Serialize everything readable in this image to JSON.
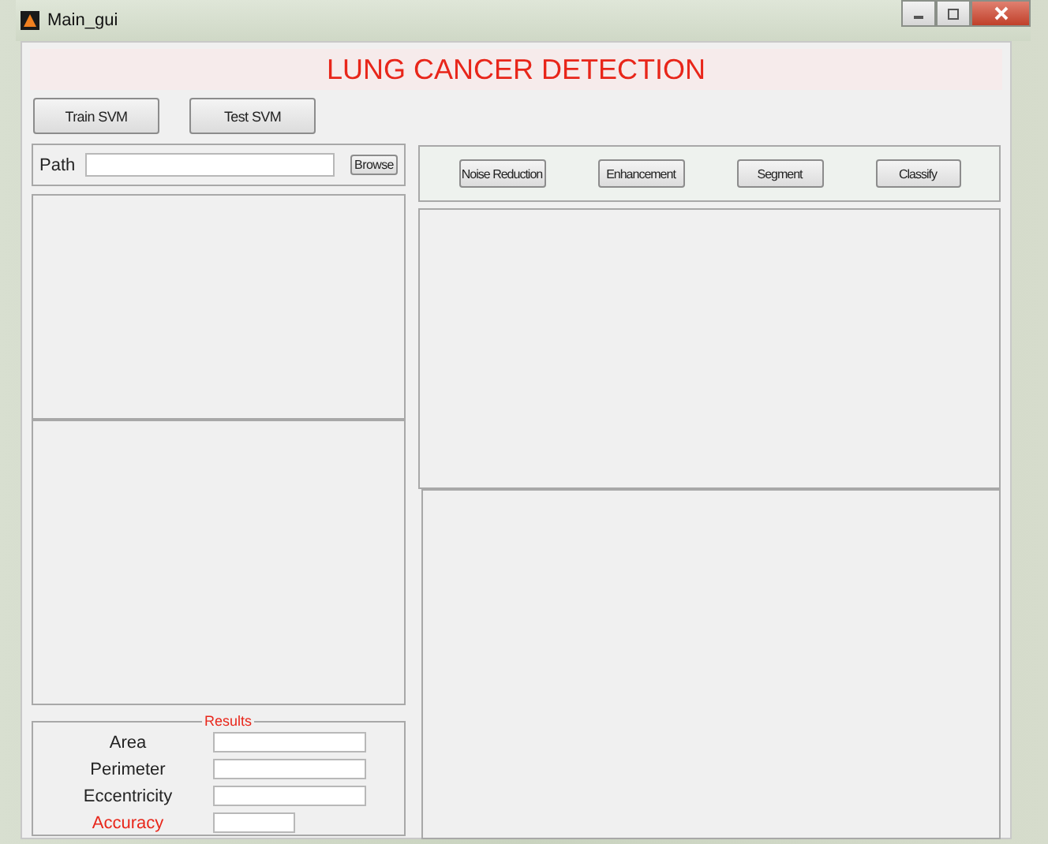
{
  "window": {
    "title": "Main_gui"
  },
  "header": {
    "title": "LUNG CANCER DETECTION"
  },
  "top_buttons": [
    "Train SVM",
    "Test SVM"
  ],
  "path": {
    "label": "Path",
    "button": "Browse"
  },
  "process_buttons": [
    "Noise Reduction",
    "Enhancement",
    "Segment",
    "Classify"
  ],
  "results": {
    "title": "Results",
    "fields": [
      {
        "label": "Area",
        "kind": "wide"
      },
      {
        "label": "Perimeter",
        "kind": "wide"
      },
      {
        "label": "Eccentricity",
        "kind": "wide"
      },
      {
        "label": "Accuracy",
        "kind": "short"
      }
    ]
  }
}
